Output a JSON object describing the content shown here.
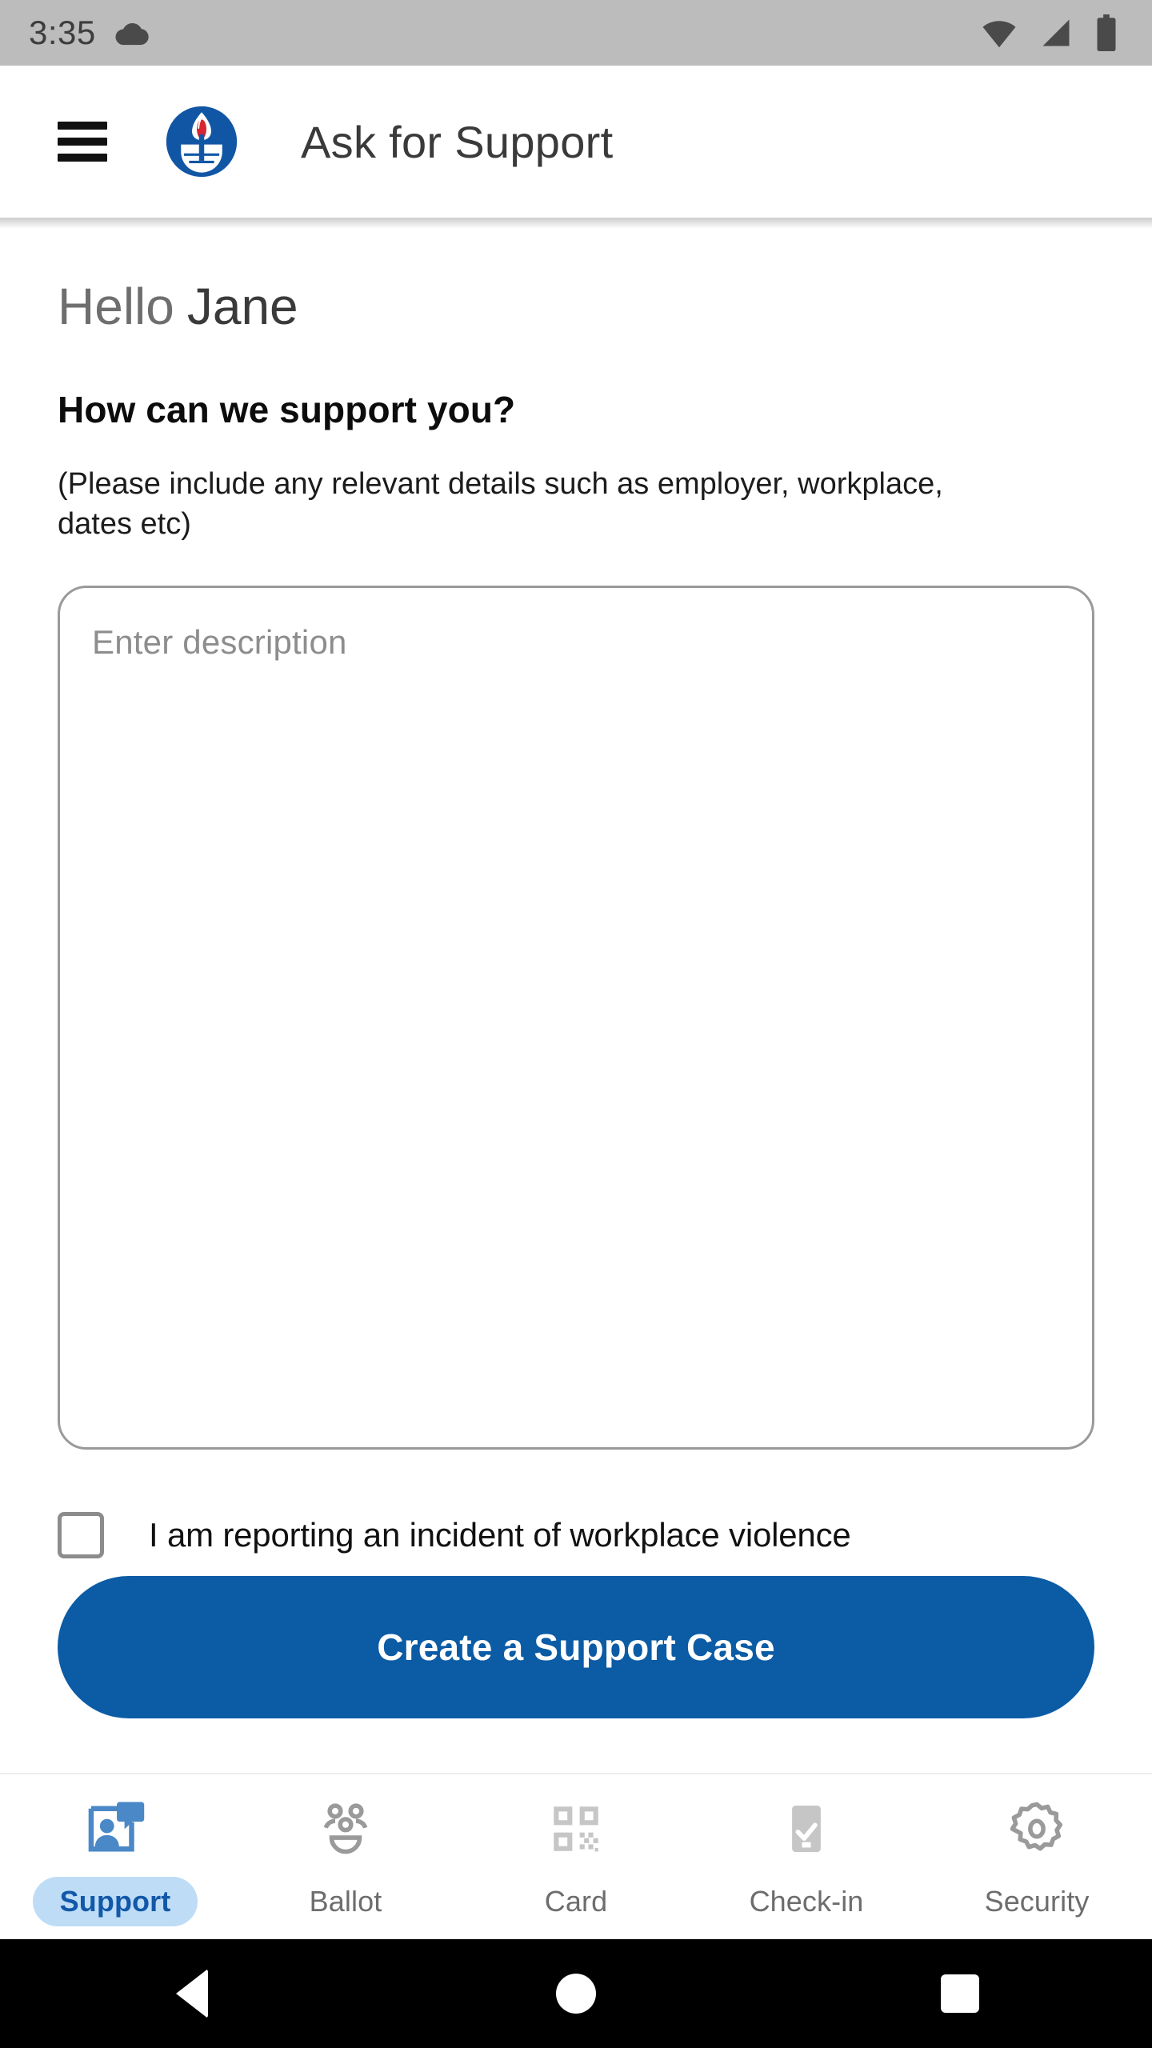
{
  "status_bar": {
    "time": "3:35",
    "icons": [
      "cloud-icon",
      "wifi-icon",
      "cellular-signal-icon",
      "battery-icon"
    ]
  },
  "app_bar": {
    "menu_icon": "hamburger-menu-icon",
    "logo_icon": "union-torch-logo-icon",
    "title": "Ask for Support"
  },
  "main": {
    "greeting_prefix": "Hello",
    "greeting_name": "Jane",
    "question": "How can we support you?",
    "hint": "(Please include any relevant details such as employer, workplace, dates etc)",
    "description_field": {
      "placeholder": "Enter description",
      "value": ""
    },
    "violence_checkbox": {
      "label": "I am reporting an incident of workplace violence",
      "checked": false
    },
    "submit_label": "Create a Support Case"
  },
  "tabs": [
    {
      "label": "Support",
      "icon": "support-person-chat-icon",
      "active": true
    },
    {
      "label": "Ballot",
      "icon": "people-group-icon",
      "active": false
    },
    {
      "label": "Card",
      "icon": "qr-code-icon",
      "active": false
    },
    {
      "label": "Check-in",
      "icon": "phone-check-icon",
      "active": false
    },
    {
      "label": "Security",
      "icon": "gear-icon",
      "active": false
    }
  ],
  "android_nav": {
    "back": "back-triangle-icon",
    "home": "home-circle-icon",
    "recents": "recents-square-icon"
  },
  "colors": {
    "primary_blue": "#0b5ba5",
    "active_tab_text": "#1258a8",
    "active_tab_pill": "#bedcf6",
    "status_bar_bg": "#bcbcbc",
    "logo_blue": "#1156a5",
    "logo_red": "#d82433"
  }
}
